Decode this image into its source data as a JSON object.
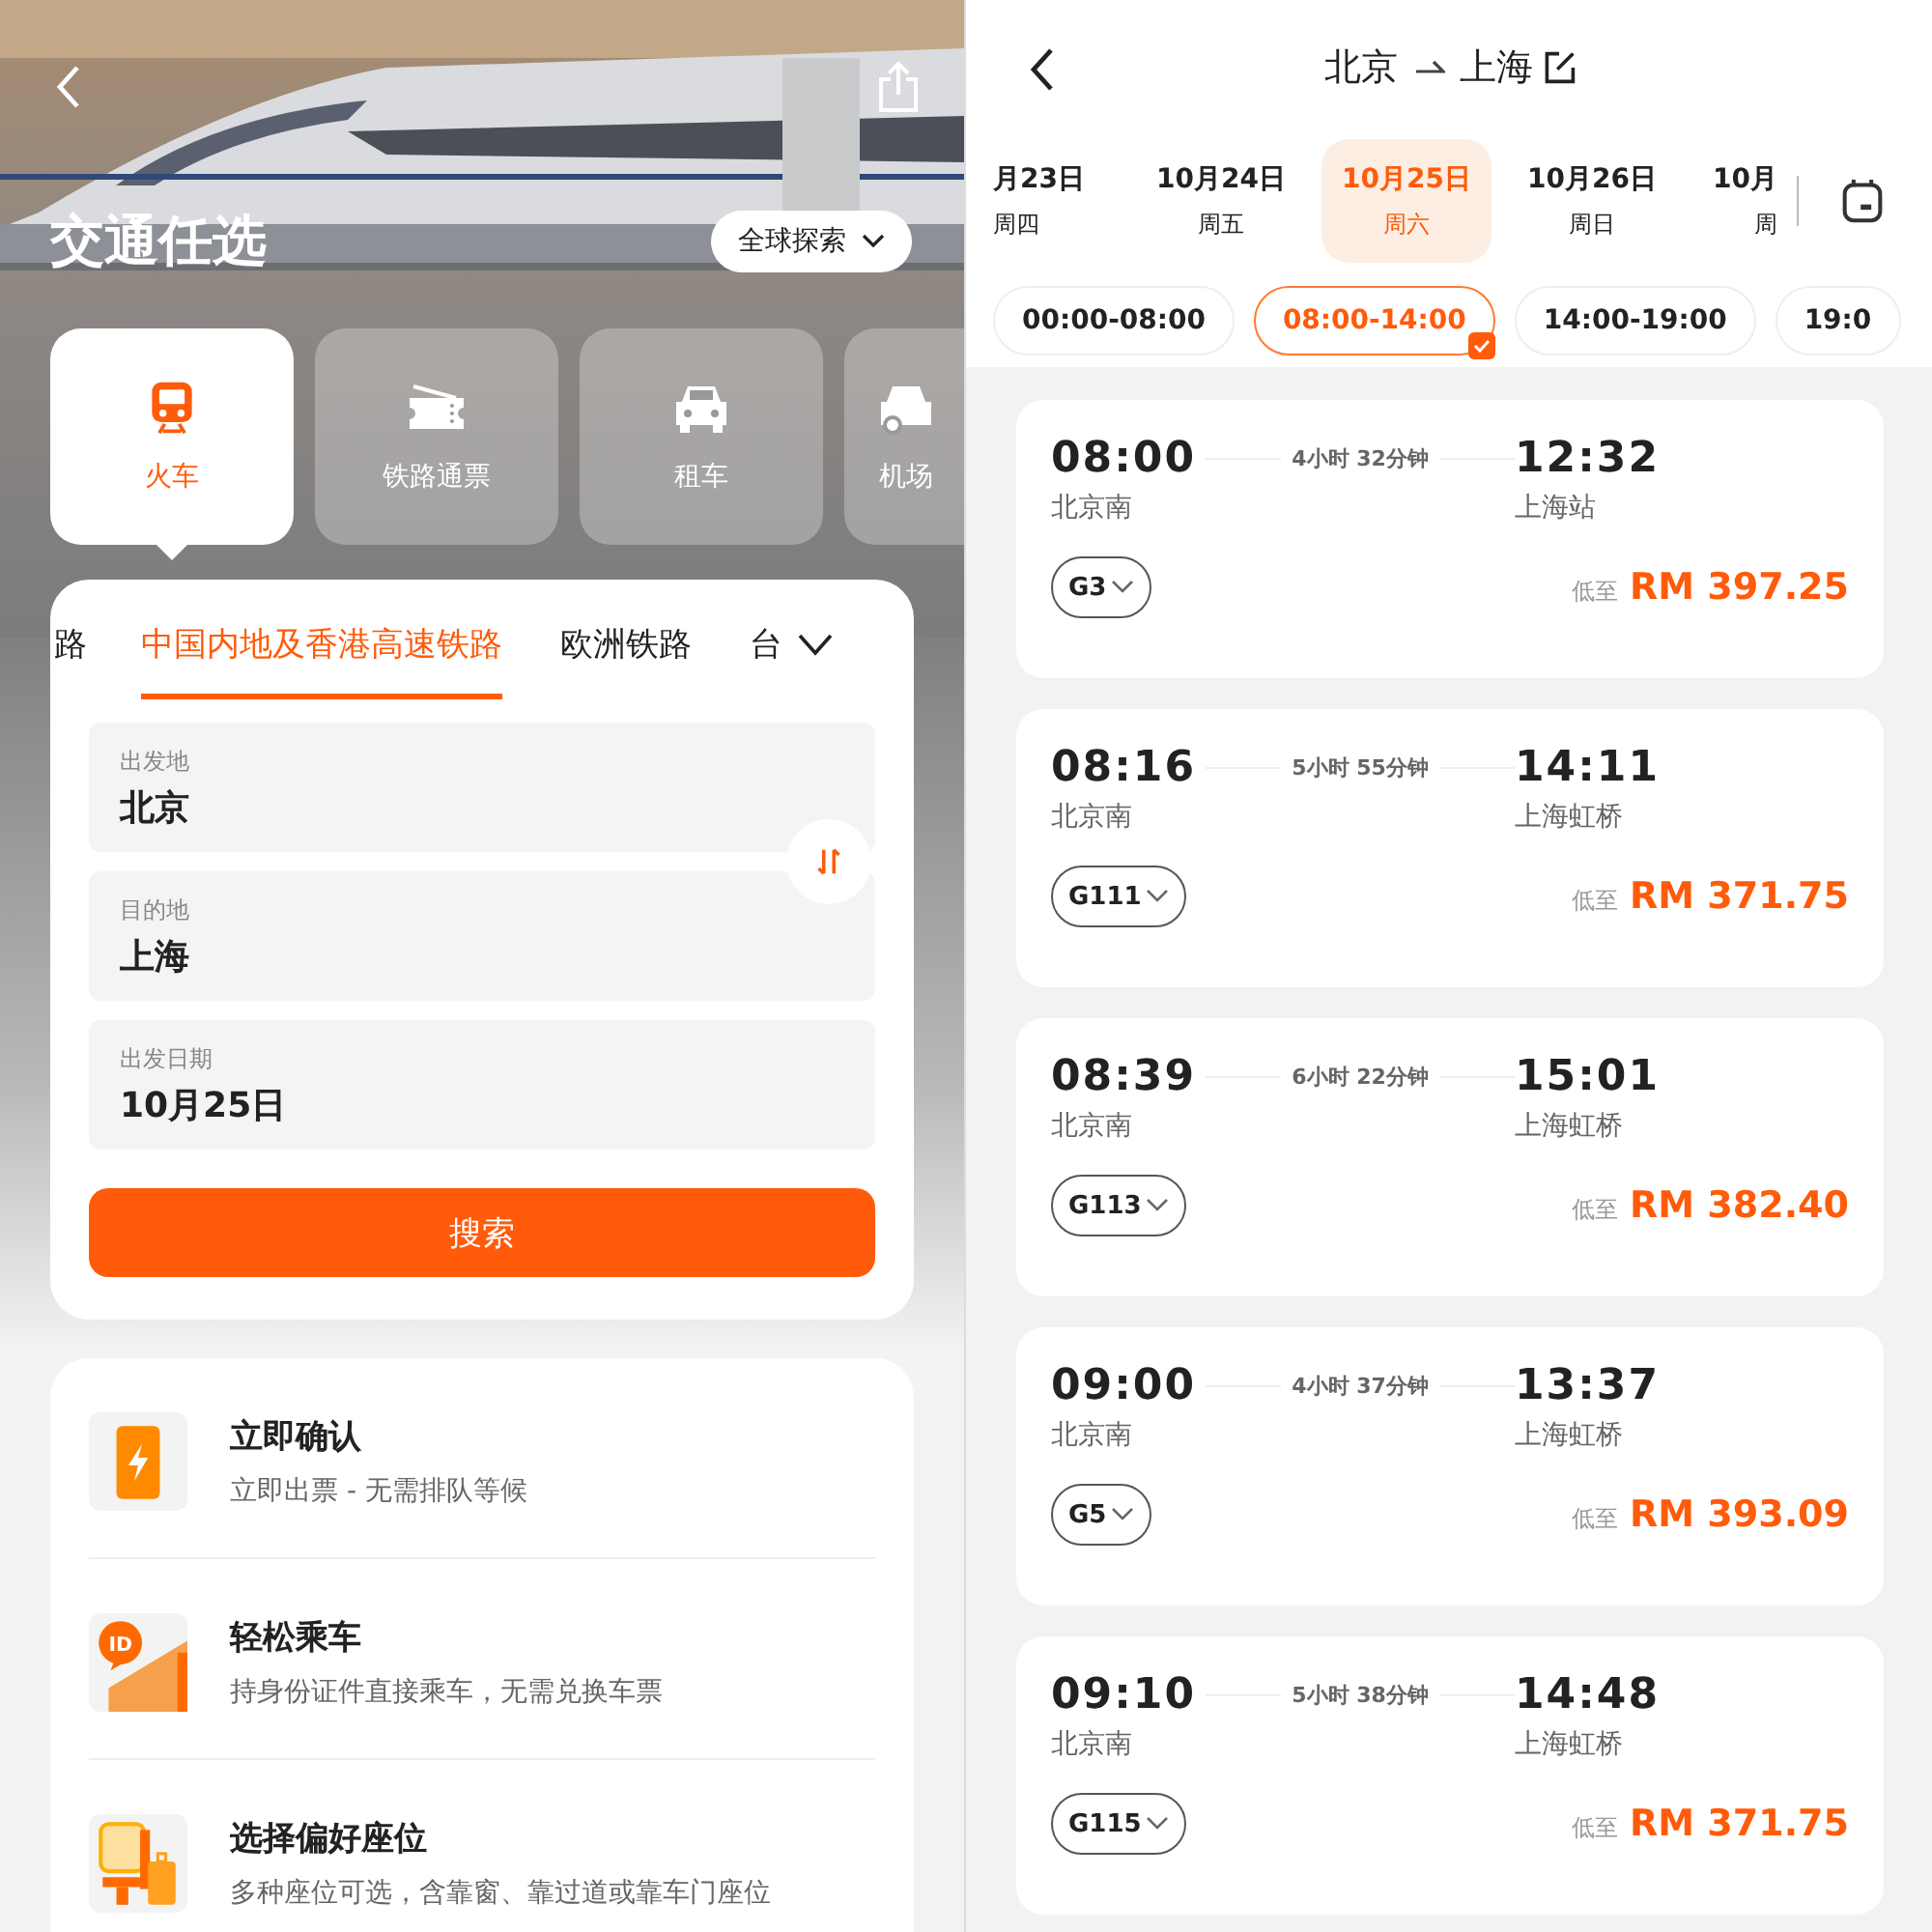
{
  "left": {
    "title": "交通任选",
    "explore_button": "全球探索",
    "categories": [
      {
        "kind": "train",
        "label": "火车",
        "selected": true
      },
      {
        "kind": "pass",
        "label": "铁路通票",
        "selected": false
      },
      {
        "kind": "car",
        "label": "租车",
        "selected": false
      },
      {
        "kind": "airport",
        "label": "机场",
        "selected": false
      }
    ],
    "rail_tabs": [
      {
        "label": "路",
        "selected": false
      },
      {
        "label": "中国内地及香港高速铁路",
        "selected": true
      },
      {
        "label": "欧洲铁路",
        "selected": false
      },
      {
        "label": "台",
        "selected": false
      }
    ],
    "fields": [
      {
        "label": "出发地",
        "value": "北京"
      },
      {
        "label": "目的地",
        "value": "上海"
      },
      {
        "label": "出发日期",
        "value": "10月25日"
      }
    ],
    "search_button": "搜索",
    "features": [
      {
        "kind": "instant",
        "title": "立即确认",
        "subtitle": "立即出票 - 无需排队等候"
      },
      {
        "kind": "id",
        "badge": "ID",
        "title": "轻松乘车",
        "subtitle": "持身份证件直接乘车，无需兑换车票"
      },
      {
        "kind": "seat",
        "title": "选择偏好座位",
        "subtitle": "多种座位可选，含靠窗、靠过道或靠车门座位"
      }
    ]
  },
  "right": {
    "from": "北京",
    "to": "上海",
    "dates": [
      {
        "date": "月23日",
        "weekday": "周四",
        "selected": false
      },
      {
        "date": "10月24日",
        "weekday": "周五",
        "selected": false
      },
      {
        "date": "10月25日",
        "weekday": "周六",
        "selected": true
      },
      {
        "date": "10月26日",
        "weekday": "周日",
        "selected": false
      },
      {
        "date": "10月",
        "weekday": "周",
        "selected": false
      }
    ],
    "time_slots": [
      {
        "label": "00:00-08:00",
        "selected": false
      },
      {
        "label": "08:00-14:00",
        "selected": true
      },
      {
        "label": "14:00-19:00",
        "selected": false
      },
      {
        "label": "19:0",
        "selected": false
      }
    ],
    "trains": [
      {
        "depart": "08:00",
        "duration": "4小时 32分钟",
        "arrive": "12:32",
        "from_station": "北京南",
        "to_station": "上海站",
        "number": "G3",
        "price_prefix": "低至",
        "price": "RM 397.25"
      },
      {
        "depart": "08:16",
        "duration": "5小时 55分钟",
        "arrive": "14:11",
        "from_station": "北京南",
        "to_station": "上海虹桥",
        "number": "G111",
        "price_prefix": "低至",
        "price": "RM 371.75"
      },
      {
        "depart": "08:39",
        "duration": "6小时 22分钟",
        "arrive": "15:01",
        "from_station": "北京南",
        "to_station": "上海虹桥",
        "number": "G113",
        "price_prefix": "低至",
        "price": "RM 382.40"
      },
      {
        "depart": "09:00",
        "duration": "4小时 37分钟",
        "arrive": "13:37",
        "from_station": "北京南",
        "to_station": "上海虹桥",
        "number": "G5",
        "price_prefix": "低至",
        "price": "RM 393.09"
      },
      {
        "depart": "09:10",
        "duration": "5小时 38分钟",
        "arrive": "14:48",
        "from_station": "北京南",
        "to_station": "上海虹桥",
        "number": "G115",
        "price_prefix": "低至",
        "price": "RM 371.75"
      }
    ]
  }
}
